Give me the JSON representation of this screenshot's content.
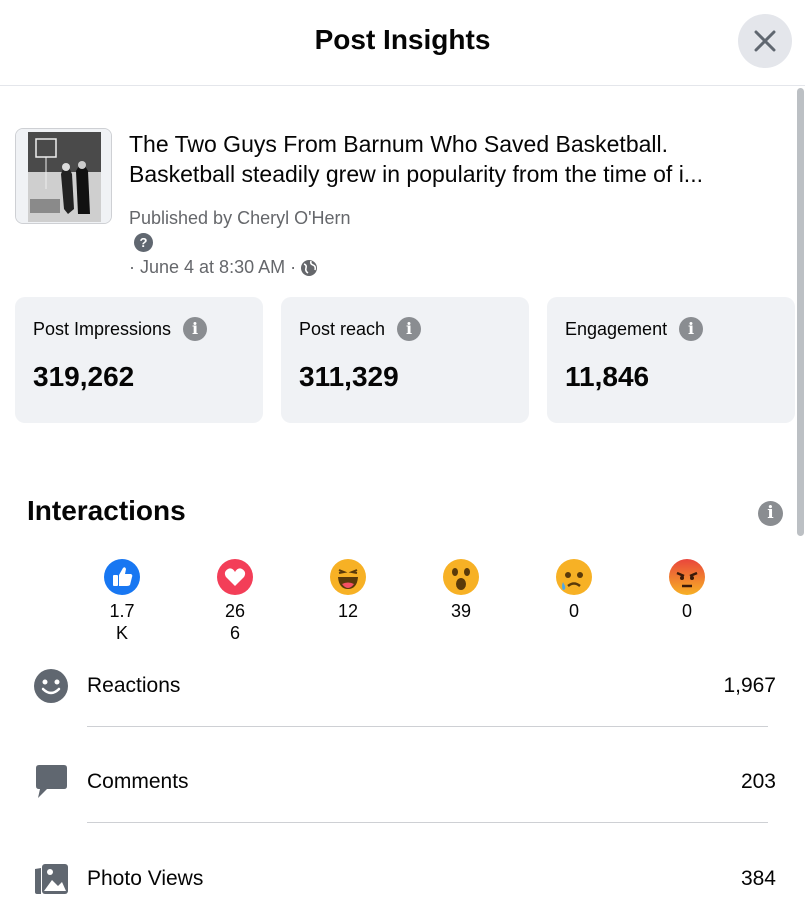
{
  "header": {
    "title": "Post Insights"
  },
  "post": {
    "title_line1": "The Two Guys From Barnum Who Saved Basketball.",
    "title_line2": "Basketball steadily grew in popularity from the time of i...",
    "published_by": "Published by Cheryl O'Hern",
    "date": "· June 4 at 8:30 AM ·",
    "help_icon_glyph": "?"
  },
  "stats": [
    {
      "label": "Post Impressions",
      "value": "319,262"
    },
    {
      "label": "Post reach",
      "value": "311,329"
    },
    {
      "label": "Engagement",
      "value": "11,846"
    }
  ],
  "interactions": {
    "title": "Interactions",
    "reactions": [
      {
        "name": "like",
        "count": "1.7 K",
        "color": "#1877f2"
      },
      {
        "name": "love",
        "count": "266",
        "color": "#f33e58"
      },
      {
        "name": "haha",
        "count": "12",
        "color": "#f7b125"
      },
      {
        "name": "wow",
        "count": "39",
        "color": "#f7b125"
      },
      {
        "name": "sad",
        "count": "0",
        "color": "#f7b125"
      },
      {
        "name": "angry",
        "count": "0",
        "color": "#e9710f"
      }
    ],
    "rows": [
      {
        "icon": "smiley-icon",
        "label": "Reactions",
        "value": "1,967"
      },
      {
        "icon": "comment-icon",
        "label": "Comments",
        "value": "203"
      },
      {
        "icon": "photo-icon",
        "label": "Photo Views",
        "value": "384"
      }
    ]
  },
  "colors": {
    "info_icon": "#8a8d91",
    "card_bg": "#f0f2f5",
    "secondary_text": "#65676b"
  }
}
